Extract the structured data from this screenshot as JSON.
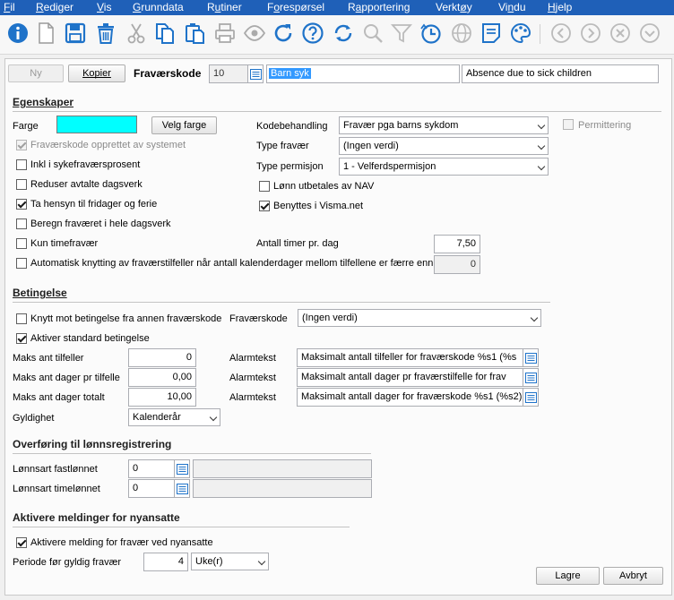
{
  "menu": {
    "items": [
      {
        "pre": "",
        "u": "F",
        "post": "il"
      },
      {
        "pre": "",
        "u": "R",
        "post": "ediger"
      },
      {
        "pre": "",
        "u": "V",
        "post": "is"
      },
      {
        "pre": "",
        "u": "G",
        "post": "runndata"
      },
      {
        "pre": "R",
        "u": "u",
        "post": "tiner"
      },
      {
        "pre": "F",
        "u": "o",
        "post": "respørsel"
      },
      {
        "pre": "R",
        "u": "a",
        "post": "pportering"
      },
      {
        "pre": "Verkt",
        "u": "ø",
        "post": "y"
      },
      {
        "pre": "Vi",
        "u": "n",
        "post": "du"
      },
      {
        "pre": "",
        "u": "H",
        "post": "jelp"
      }
    ]
  },
  "toolbar": {
    "icons": [
      "info-icon",
      "new-document-icon",
      "save-icon",
      "delete-icon",
      "cut-icon",
      "copy-icon",
      "paste-icon",
      "print-icon",
      "preview-icon",
      "refresh-icon",
      "help-icon",
      "refresh-alt-icon",
      "search-icon",
      "filter-icon",
      "history-icon",
      "web-icon",
      "notes-icon",
      "settings-palette-icon",
      "arrow-left-icon",
      "arrow-right-icon",
      "close-circle-icon",
      "arrow-down-icon"
    ],
    "accent": "#1f73c9"
  },
  "header": {
    "ny": "Ny",
    "kopier": "Kopier",
    "code_label": "Fraværskode",
    "code_value": "10",
    "name_value": "Barn syk",
    "description_value": "Absence due to sick children"
  },
  "egenskaper": {
    "title": "Egenskaper",
    "farge_label": "Farge",
    "farge_color": "#00ffff",
    "velg_farge": "Velg farge",
    "system_created": "Fraværskode opprettet av systemet",
    "inkl_sykefravaer": "Inkl i sykefraværsprosent",
    "reduser": "Reduser avtalte dagsverk",
    "ta_hensyn": "Ta hensyn til fridager og ferie",
    "beregn": "Beregn fraværet i hele dagsverk",
    "kun_time": "Kun timefravær",
    "auto_knytting": "Automatisk knytting av fraværstilfeller når antall kalenderdager mellom tilfellene er færre enn",
    "auto_knytting_value": "0",
    "kodebehandling_label": "Kodebehandling",
    "kodebehandling_value": "Fravær pga barns sykdom",
    "permittering": "Permittering",
    "type_fravaer_label": "Type fravær",
    "type_fravaer_value": "(Ingen verdi)",
    "type_permisjon_label": "Type permisjon",
    "type_permisjon_value": "1 - Velferdspermisjon",
    "lonn_nav": "Lønn utbetales av NAV",
    "benyttes_visma": "Benyttes i Visma.net",
    "antall_timer_label": "Antall timer pr. dag",
    "antall_timer_value": "7,50"
  },
  "betingelse": {
    "title": "Betingelse",
    "knytt_mot": "Knytt mot betingelse fra annen fraværskode",
    "fravaerskode_label": "Fraværskode",
    "fravaerskode_value": "(Ingen verdi)",
    "aktiver_standard": "Aktiver standard betingelse",
    "maks_tilfeller_label": "Maks ant tilfeller",
    "maks_tilfeller_value": "0",
    "maks_dager_tilfelle_label": "Maks ant dager pr tilfelle",
    "maks_dager_tilfelle_value": "0,00",
    "maks_dager_totalt_label": "Maks ant dager totalt",
    "maks_dager_totalt_value": "10,00",
    "alarm_label": "Alarmtekst",
    "alarm_1": "Maksimalt antall tilfeller for fraværskode %s1 (%s",
    "alarm_2": "Maksimalt antall dager pr fraværstilfelle for frav",
    "alarm_3": "Maksimalt antall dager for fraværskode %s1 (%s2)",
    "gyldighet_label": "Gyldighet",
    "gyldighet_value": "Kalenderår"
  },
  "overforing": {
    "title": "Overføring til lønnsregistrering",
    "fast_label": "Lønnsart fastlønnet",
    "fast_value": "0",
    "time_label": "Lønnsart timelønnet",
    "time_value": "0"
  },
  "meldinger": {
    "title": "Aktivere meldinger for nyansatte",
    "aktivere_melding": "Aktivere melding for fravær ved nyansatte",
    "periode_label": "Periode før gyldig fravær",
    "periode_value": "4",
    "periode_unit": "Uke(r)"
  },
  "footer": {
    "lagre": "Lagre",
    "avbryt": "Avbryt"
  }
}
